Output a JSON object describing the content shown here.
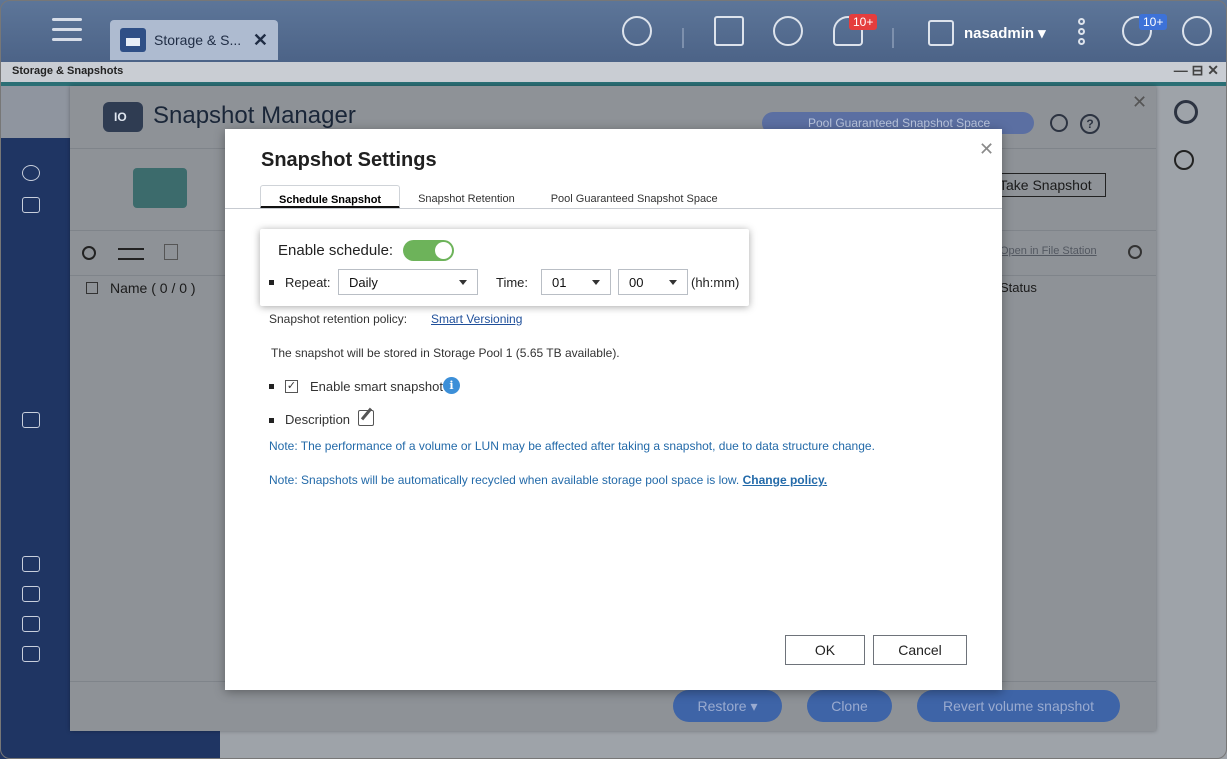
{
  "taskbar": {
    "app_tab_label": "Storage & S...",
    "notifications_badge": "10+",
    "info_badge": "10+",
    "username": "nasadmin ▾"
  },
  "window": {
    "title": "Storage & Snapshots",
    "controls": "— ⊟ ✕"
  },
  "snapshot_manager": {
    "title": "Snapshot Manager",
    "pool_pill": "Pool Guaranteed Snapshot Space",
    "take_snapshot": "Take Snapshot",
    "open_file_station": "Open in File Station",
    "name_header": "Name ( 0 / 0 )",
    "status_header": "Status",
    "restore": "Restore ▾",
    "clone": "Clone",
    "revert": "Revert volume snapshot"
  },
  "modal": {
    "title": "Snapshot Settings",
    "tabs": [
      "Schedule Snapshot",
      "Snapshot Retention",
      "Pool Guaranteed Snapshot Space"
    ],
    "enable_schedule_label": "Enable schedule:",
    "enable_schedule_on": true,
    "repeat_label": "Repeat:",
    "repeat_value": "Daily",
    "time_label": "Time:",
    "hour_value": "01",
    "minute_value": "00",
    "time_format": "(hh:mm)",
    "retention_label": "Snapshot retention policy:",
    "retention_link": "Smart Versioning",
    "stored_text": "The snapshot will be stored in Storage Pool 1 (5.65 TB available).",
    "smart_snapshot_label": "Enable smart snapshot",
    "smart_snapshot_checked": true,
    "description_label": "Description",
    "note1": "Note: The performance of a volume or LUN may be affected after taking a snapshot, due to data structure change.",
    "note2": "Note: Snapshots will be automatically recycled when available storage pool space is low.",
    "note2_link": "Change policy.",
    "ok": "OK",
    "cancel": "Cancel"
  },
  "colors": {
    "toggle_on": "#6db35a",
    "link": "#1f4f9a",
    "note": "#236aa9",
    "taskbar": "#4c6387"
  }
}
